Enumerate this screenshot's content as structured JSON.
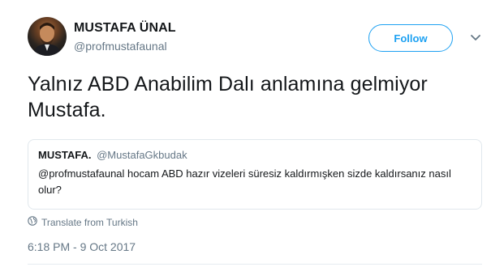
{
  "author": {
    "name": "MUSTAFA ÜNAL",
    "handle": "@profmustafaunal",
    "follow_label": "Follow"
  },
  "tweet": {
    "text": "Yalnız ABD Anabilim Dalı anlamına gelmiyor Mustafa."
  },
  "quoted_tweet": {
    "name": "MUSTAFA.",
    "handle": "@MustafaGkbudak",
    "text": "@profmustafaunal hocam ABD hazır vizeleri süresiz kaldırmışken sizde kaldırsanız nasıl olur?"
  },
  "translate_label": "Translate from Turkish",
  "timestamp": "6:18 PM - 9 Oct 2017",
  "icons": {
    "avatar": "profile-photo",
    "caret": "chevron-down-icon",
    "translate": "globe-icon"
  },
  "colors": {
    "accent": "#1da1f2",
    "secondary_text": "#657786",
    "border": "#e1e8ed"
  }
}
